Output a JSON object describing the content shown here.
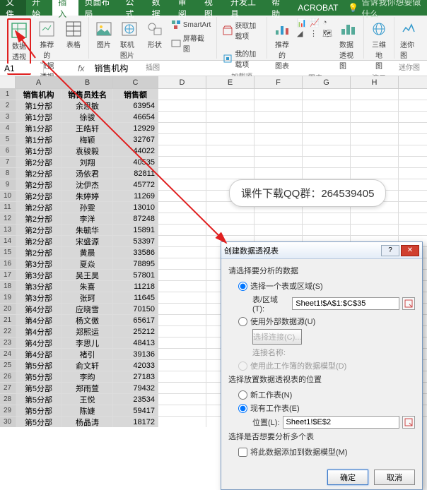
{
  "tabs": {
    "file": "文件",
    "items": [
      "开始",
      "插入",
      "页面布局",
      "公式",
      "数据",
      "审阅",
      "视图",
      "开发工具",
      "帮助",
      "ACROBAT"
    ],
    "activeIndex": 1,
    "tell": "告诉我你想要做什么"
  },
  "ribbon": {
    "groups": [
      {
        "label": "表格",
        "buttons": [
          {
            "name": "pivot-table",
            "text": "数据\n透视表"
          },
          {
            "name": "recommended-pivot",
            "text": "推荐的\n数据透视表"
          },
          {
            "name": "table",
            "text": "表格"
          }
        ]
      },
      {
        "label": "插图",
        "buttons": [
          {
            "name": "pictures",
            "text": "图片"
          },
          {
            "name": "online-pictures",
            "text": "联机图片"
          },
          {
            "name": "shapes",
            "text": "形状"
          },
          {
            "name": "smartart",
            "text": "SmartArt"
          },
          {
            "name": "screenshot",
            "text": "屏幕截图"
          }
        ]
      },
      {
        "label": "加载项",
        "buttons": [
          {
            "name": "get-addins",
            "text": "获取加载项"
          },
          {
            "name": "my-addins",
            "text": "我的加载项"
          }
        ]
      },
      {
        "label": "图表",
        "buttons": [
          {
            "name": "recommended-charts",
            "text": "推荐的\n图表"
          },
          {
            "name": "charts",
            "text": ""
          },
          {
            "name": "pivot-chart",
            "text": "数据透视图"
          }
        ]
      },
      {
        "label": "演示",
        "buttons": [
          {
            "name": "3dmap",
            "text": "三维地\n图"
          }
        ]
      },
      {
        "label": "迷你图",
        "buttons": [
          {
            "name": "sparkline",
            "text": "迷你图"
          }
        ]
      }
    ]
  },
  "formula": {
    "namebox": "A1",
    "value": "销售机构"
  },
  "columns": [
    "A",
    "B",
    "C",
    "D",
    "E",
    "F",
    "G",
    "H"
  ],
  "chart_data": {
    "type": "table",
    "headers": [
      "销售机构",
      "销售员姓名",
      "销售额"
    ],
    "rows": [
      [
        "第1分部",
        "余思敏",
        63954
      ],
      [
        "第1分部",
        "徐骏",
        46654
      ],
      [
        "第1分部",
        "王皓轩",
        12929
      ],
      [
        "第1分部",
        "梅颖",
        32767
      ],
      [
        "第1分部",
        "袁骏毅",
        44022
      ],
      [
        "第2分部",
        "刘翔",
        40535
      ],
      [
        "第2分部",
        "汤依君",
        82811
      ],
      [
        "第2分部",
        "沈伊杰",
        45772
      ],
      [
        "第2分部",
        "朱婷婷",
        11269
      ],
      [
        "第2分部",
        "孙雯",
        13010
      ],
      [
        "第2分部",
        "李洋",
        87248
      ],
      [
        "第2分部",
        "朱毓华",
        15891
      ],
      [
        "第2分部",
        "宋盛源",
        53397
      ],
      [
        "第2分部",
        "黄晨",
        33586
      ],
      [
        "第3分部",
        "夏焱",
        78895
      ],
      [
        "第3分部",
        "吴王昊",
        57801
      ],
      [
        "第3分部",
        "朱喜",
        11218
      ],
      [
        "第3分部",
        "张珂",
        11645
      ],
      [
        "第4分部",
        "应晓雪",
        70150
      ],
      [
        "第4分部",
        "杨文傲",
        65617
      ],
      [
        "第4分部",
        "郑熙运",
        25212
      ],
      [
        "第4分部",
        "李思儿",
        48413
      ],
      [
        "第4分部",
        "褚引",
        39136
      ],
      [
        "第5分部",
        "俞文轩",
        42033
      ],
      [
        "第5分部",
        "李昀",
        27183
      ],
      [
        "第5分部",
        "郑雨萱",
        79432
      ],
      [
        "第5分部",
        "王悦",
        23534
      ],
      [
        "第5分部",
        "陈婕",
        59417
      ],
      [
        "第5分部",
        "杨晶涛",
        18172
      ]
    ]
  },
  "note": {
    "text": "课件下载QQ群：",
    "qq": "264539405"
  },
  "dialog": {
    "title": "创建数据透视表",
    "s1": "请选择要分析的数据",
    "opt1": "选择一个表或区域(S)",
    "lbl_range": "表/区域(T):",
    "val_range": "Sheet1!$A$1:$C$35",
    "opt2": "使用外部数据源(U)",
    "btn_conn": "选择连接(C)...",
    "lbl_connname": "连接名称:",
    "opt3": "使用此工作簿的数据模型(D)",
    "s2": "选择放置数据透视表的位置",
    "opt4": "新工作表(N)",
    "opt5": "现有工作表(E)",
    "lbl_loc": "位置(L):",
    "val_loc": "Sheet1!$E$2",
    "s3": "选择是否想要分析多个表",
    "chk": "将此数据添加到数据模型(M)",
    "ok": "确定",
    "cancel": "取消"
  }
}
